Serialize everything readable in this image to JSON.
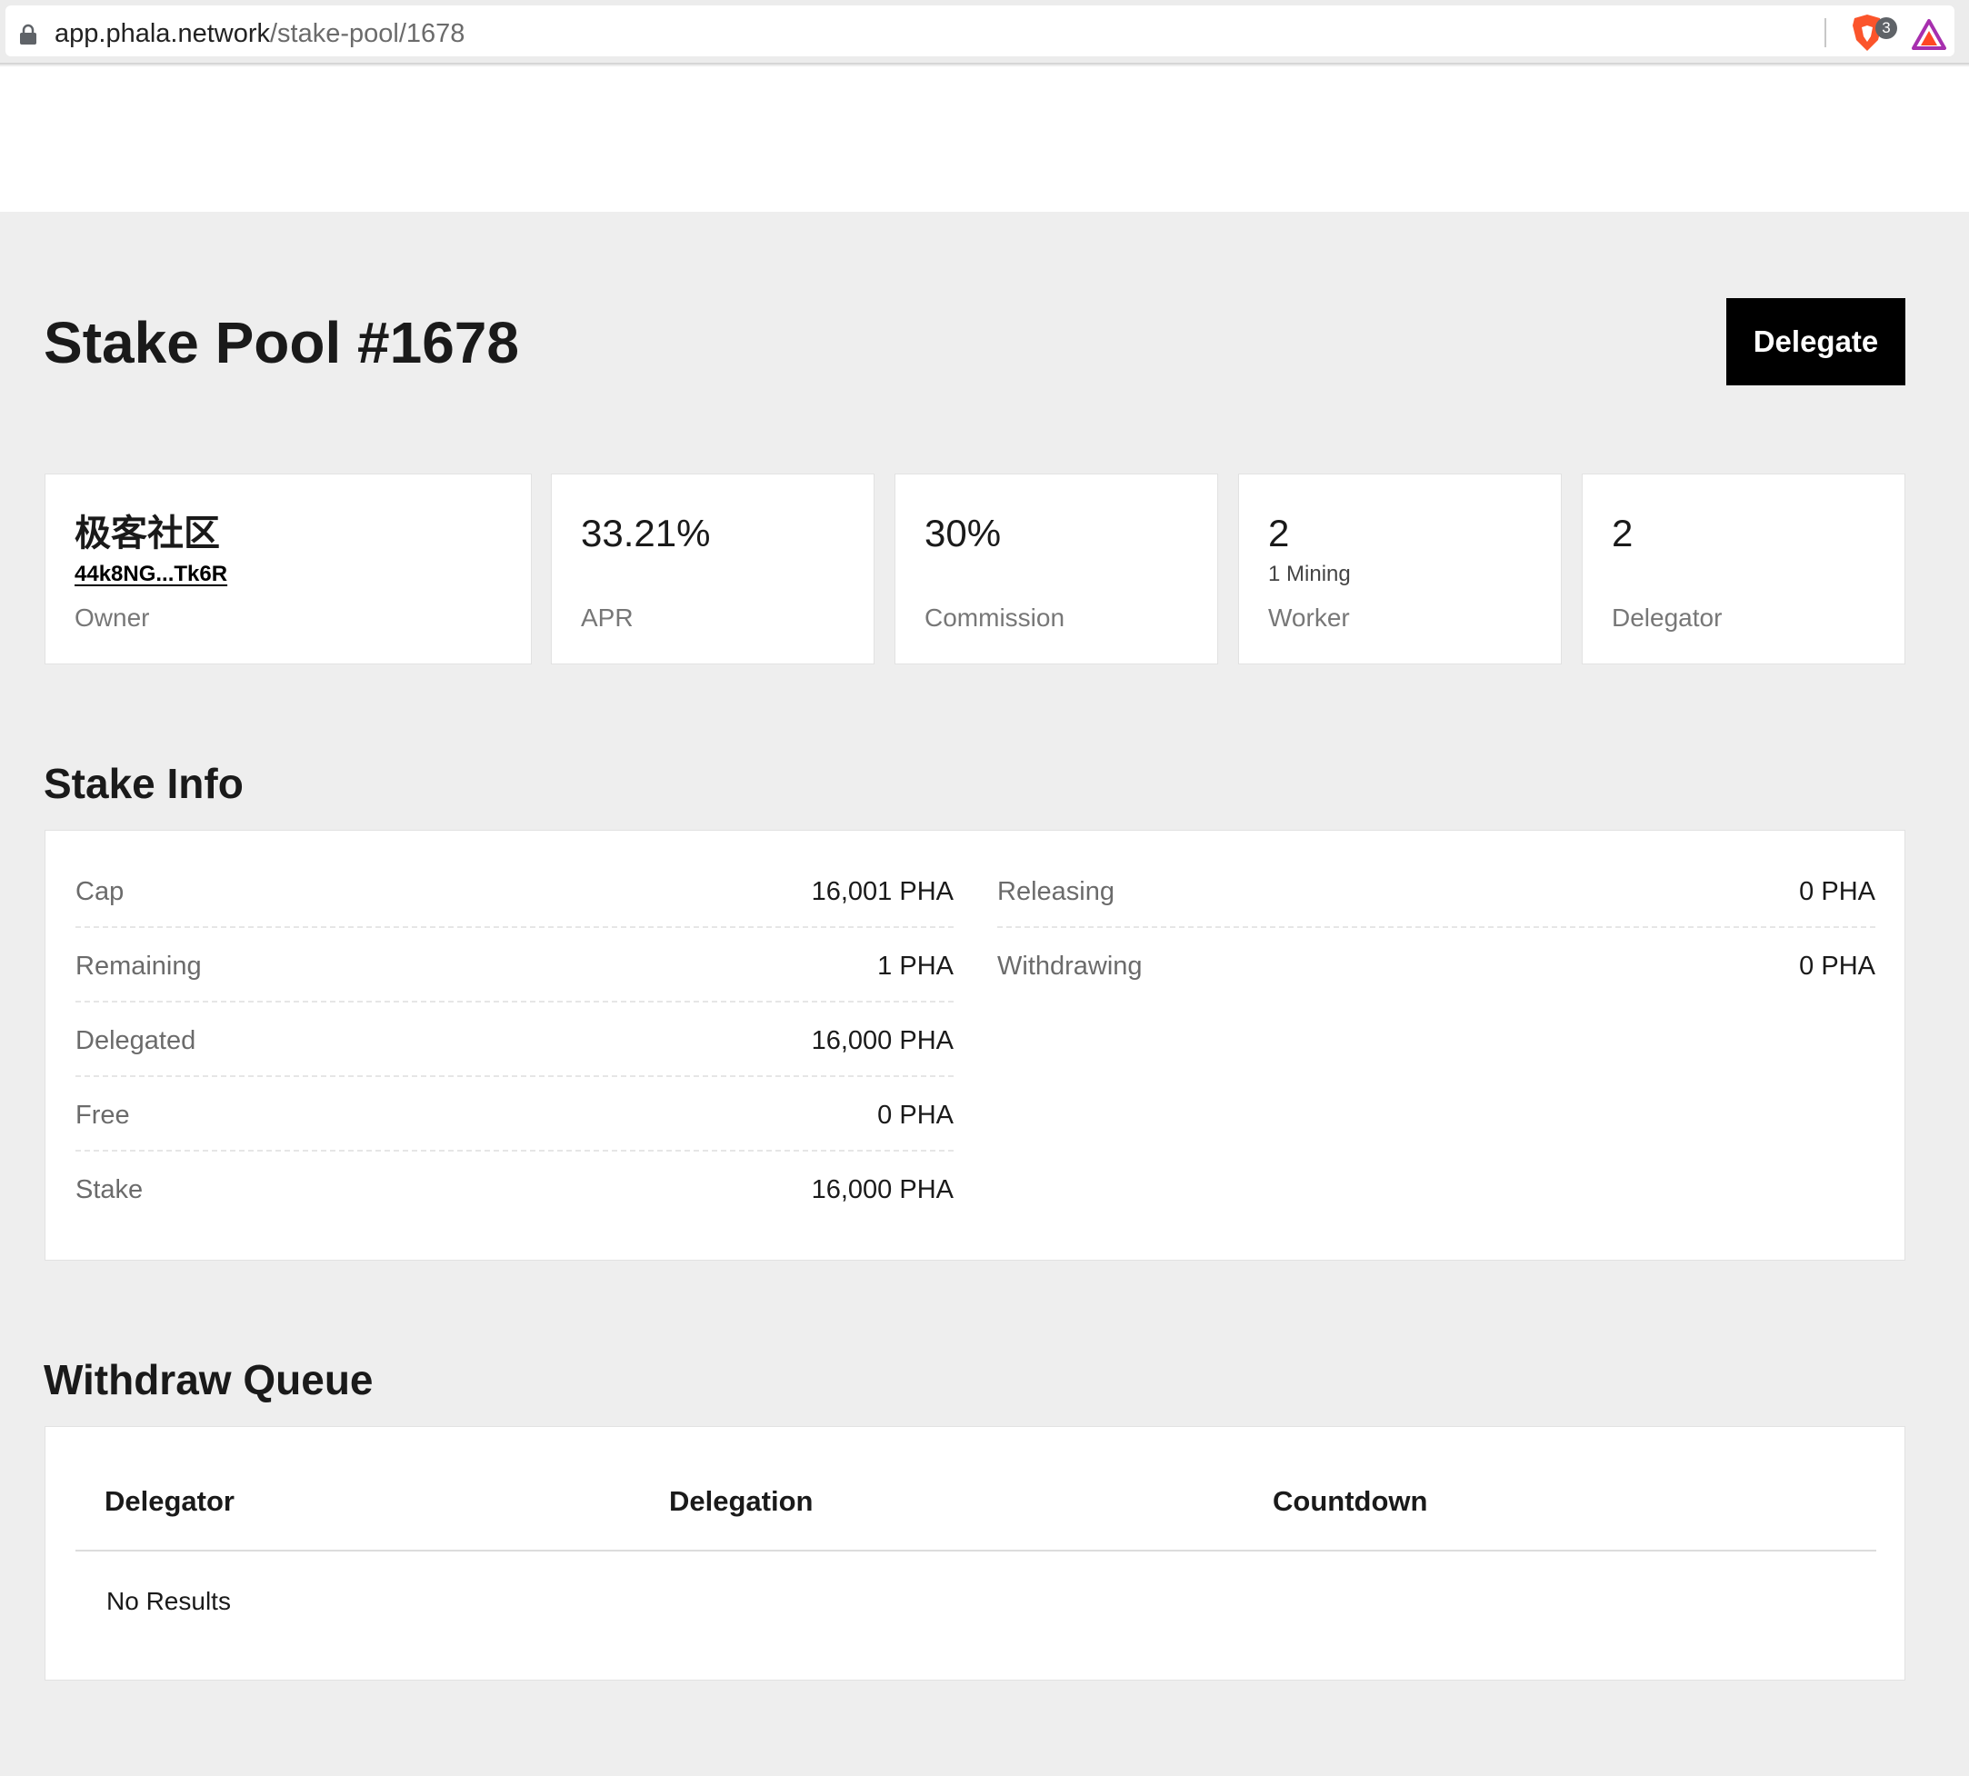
{
  "browser": {
    "url_host": "app.phala.network",
    "url_path": "/stake-pool/1678",
    "extension_badge": "3"
  },
  "page": {
    "title": "Stake Pool #1678",
    "delegate_label": "Delegate"
  },
  "stats": {
    "owner": {
      "name": "极客社区",
      "address": "44k8NG...Tk6R",
      "label": "Owner"
    },
    "apr": {
      "value": "33.21%",
      "label": "APR"
    },
    "commission": {
      "value": "30%",
      "label": "Commission"
    },
    "worker": {
      "value": "2",
      "sub": "1 Mining",
      "label": "Worker"
    },
    "delegator": {
      "value": "2",
      "label": "Delegator"
    }
  },
  "stake_info": {
    "title": "Stake Info",
    "left": [
      {
        "key": "Cap",
        "value": "16,001 PHA"
      },
      {
        "key": "Remaining",
        "value": "1 PHA"
      },
      {
        "key": "Delegated",
        "value": "16,000 PHA"
      },
      {
        "key": "Free",
        "value": "0 PHA"
      },
      {
        "key": "Stake",
        "value": "16,000 PHA"
      }
    ],
    "right": [
      {
        "key": "Releasing",
        "value": "0 PHA"
      },
      {
        "key": "Withdrawing",
        "value": "0 PHA"
      }
    ]
  },
  "withdraw_queue": {
    "title": "Withdraw Queue",
    "columns": [
      "Delegator",
      "Delegation",
      "Countdown"
    ],
    "empty_text": "No Results"
  }
}
